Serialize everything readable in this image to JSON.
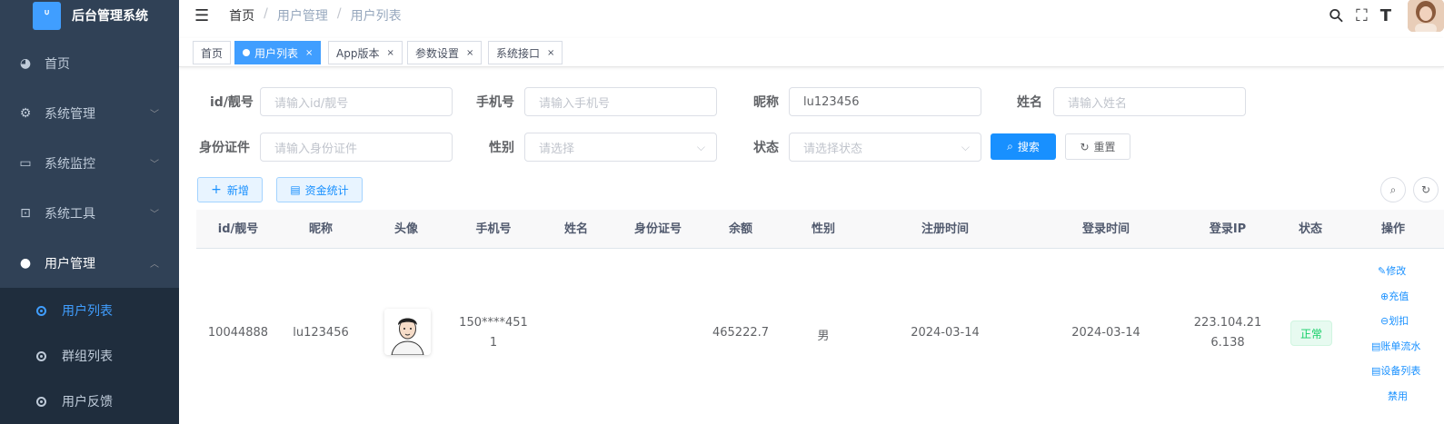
{
  "app": {
    "title": "后台管理系统",
    "logo_glyph": "ᐡ"
  },
  "sidebar": {
    "items": [
      {
        "label": "首页",
        "icon": "dashboard-icon",
        "glyph": "◕"
      },
      {
        "label": "系统管理",
        "icon": "gear-icon",
        "glyph": "⚙"
      },
      {
        "label": "系统监控",
        "icon": "monitor-icon",
        "glyph": "▭"
      },
      {
        "label": "系统工具",
        "icon": "toolbox-icon",
        "glyph": "⊡"
      },
      {
        "label": "用户管理",
        "icon": "user-icon",
        "glyph": "●"
      }
    ],
    "chevron_down": "﹀",
    "chevron_up": "︿",
    "subitems": [
      {
        "label": "用户列表",
        "active": true
      },
      {
        "label": "群组列表",
        "active": false
      },
      {
        "label": "用户反馈",
        "active": false
      }
    ]
  },
  "navbar": {
    "hamburger_glyph": "☰",
    "breadcrumb": [
      "首页",
      "用户管理",
      "用户列表"
    ],
    "separator": "/",
    "icons": {
      "search": "⚲",
      "fullscreen": "⛶",
      "font": "T"
    }
  },
  "tags": [
    {
      "label": "首页",
      "active": false,
      "closable": false
    },
    {
      "label": "用户列表",
      "active": true,
      "closable": true
    },
    {
      "label": "App版本",
      "active": false,
      "closable": true
    },
    {
      "label": "参数设置",
      "active": false,
      "closable": true
    },
    {
      "label": "系统接口",
      "active": false,
      "closable": true
    }
  ],
  "tag_close_glyph": "×",
  "filters": {
    "id": {
      "label": "id/靓号",
      "placeholder": "请输入id/靓号",
      "value": ""
    },
    "phone": {
      "label": "手机号",
      "placeholder": "请输入手机号",
      "value": ""
    },
    "nickname": {
      "label": "昵称",
      "placeholder": "",
      "value": "lu123456"
    },
    "name": {
      "label": "姓名",
      "placeholder": "请输入姓名",
      "value": ""
    },
    "idcard": {
      "label": "身份证件",
      "placeholder": "请输入身份证件",
      "value": ""
    },
    "gender": {
      "label": "性别",
      "placeholder": "请选择",
      "value": ""
    },
    "status": {
      "label": "状态",
      "placeholder": "请选择状态",
      "value": ""
    }
  },
  "select_arrow": "⌵",
  "buttons": {
    "search": "搜索",
    "search_icon": "⌕",
    "reset": "重置",
    "reset_icon": "↻",
    "add": "新增",
    "add_icon": "+",
    "funds": "资金统计",
    "funds_icon": "▤",
    "table_search_icon": "⌕",
    "table_refresh_icon": "↻"
  },
  "table": {
    "columns": [
      "id/靓号",
      "昵称",
      "头像",
      "手机号",
      "姓名",
      "身份证号",
      "余额",
      "性别",
      "注册时间",
      "登录时间",
      "登录IP",
      "状态",
      "操作"
    ],
    "rows": [
      {
        "id": "10044888",
        "nickname": "lu123456",
        "phone_line1": "150****451",
        "phone_line2": "1",
        "name": "",
        "idcard": "",
        "balance": "465222.7",
        "gender": "男",
        "register_time": "2024-03-14",
        "login_time": "2024-03-14",
        "ip_line1": "223.104.21",
        "ip_line2": "6.138",
        "status": "正常",
        "actions": [
          {
            "label": "修改",
            "icon": "✎"
          },
          {
            "label": "充值",
            "icon": "⊕"
          },
          {
            "label": "划扣",
            "icon": "⊖"
          },
          {
            "label": "账单流水",
            "icon": "▤"
          },
          {
            "label": "设备列表",
            "icon": "▤"
          },
          {
            "label": "禁用",
            "icon": ""
          }
        ]
      }
    ]
  }
}
